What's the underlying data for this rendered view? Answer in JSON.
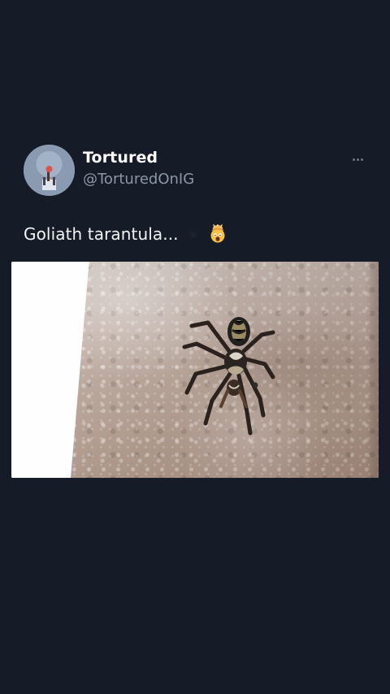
{
  "tweet": {
    "display_name": "Tortured",
    "handle": "@TorturedOnIG",
    "text": "Goliath tarantula...",
    "emojis": [
      "spider-icon",
      "exploding-head-emoji"
    ],
    "media_alt": "Spider on a textured wall"
  },
  "colors": {
    "background": "#151c27",
    "primary_text": "#ffffff",
    "secondary_text": "#8c97a5"
  }
}
